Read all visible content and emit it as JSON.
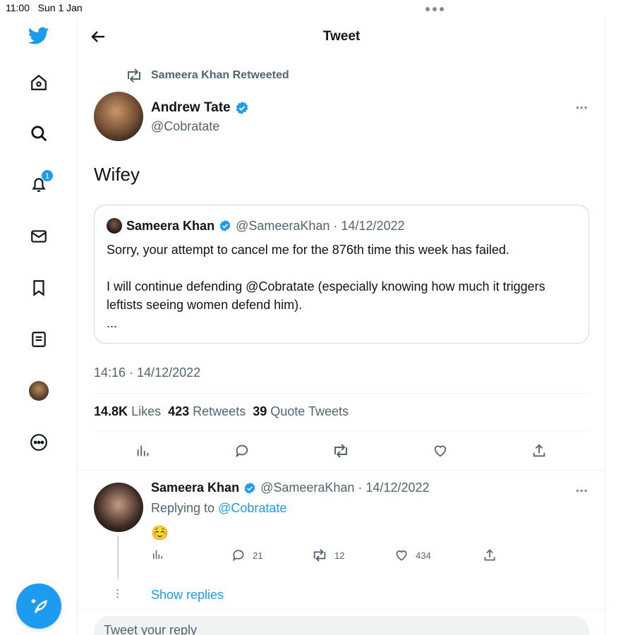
{
  "status_bar": {
    "time": "11:00",
    "date": "Sun 1 Jan"
  },
  "header": {
    "title": "Tweet",
    "back_icon": "back-arrow-icon"
  },
  "sidebar": {
    "items": [
      {
        "name": "twitter-logo",
        "icon": "twitter-bird-icon"
      },
      {
        "name": "home",
        "icon": "home-icon"
      },
      {
        "name": "explore",
        "icon": "search-icon"
      },
      {
        "name": "notifications",
        "icon": "bell-icon",
        "badge": "1"
      },
      {
        "name": "messages",
        "icon": "mail-icon"
      },
      {
        "name": "bookmarks",
        "icon": "bookmark-icon"
      },
      {
        "name": "lists",
        "icon": "list-icon"
      },
      {
        "name": "profile",
        "icon": "avatar"
      },
      {
        "name": "more",
        "icon": "more-circle-icon"
      }
    ],
    "compose_icon": "compose-tweet-icon"
  },
  "tweet": {
    "retweeted_by": "Sameera Khan Retweeted",
    "author_name": "Andrew Tate",
    "author_handle": "@Cobratate",
    "text": "Wifey",
    "quote": {
      "name": "Sameera Khan",
      "meta": "@SameeraKhan · 14/12/2022",
      "line1": "Sorry, your attempt to cancel me for the 876th time this week has failed.",
      "line2": "I will continue defending @Cobratate (especially knowing how much it triggers leftists seeing women defend him).",
      "ellipsis": "..."
    },
    "timestamp": "14:16 · 14/12/2022",
    "stats": {
      "likes_count": "14.8K",
      "likes_label": "Likes",
      "retweets_count": "423",
      "retweets_label": "Retweets",
      "quotes_count": "39",
      "quotes_label": "Quote Tweets"
    }
  },
  "reply": {
    "name": "Sameera Khan",
    "meta": "@SameeraKhan · 14/12/2022",
    "replying_prefix": "Replying to",
    "replying_to": "@Cobratate",
    "text": "☺️",
    "reply_count": "21",
    "retweet_count": "12",
    "like_count": "434",
    "show_replies": "Show replies"
  },
  "composer": {
    "placeholder": "Tweet your reply"
  },
  "colors": {
    "accent": "#1d9bf0",
    "muted": "#536471",
    "border": "#eff3f4"
  }
}
